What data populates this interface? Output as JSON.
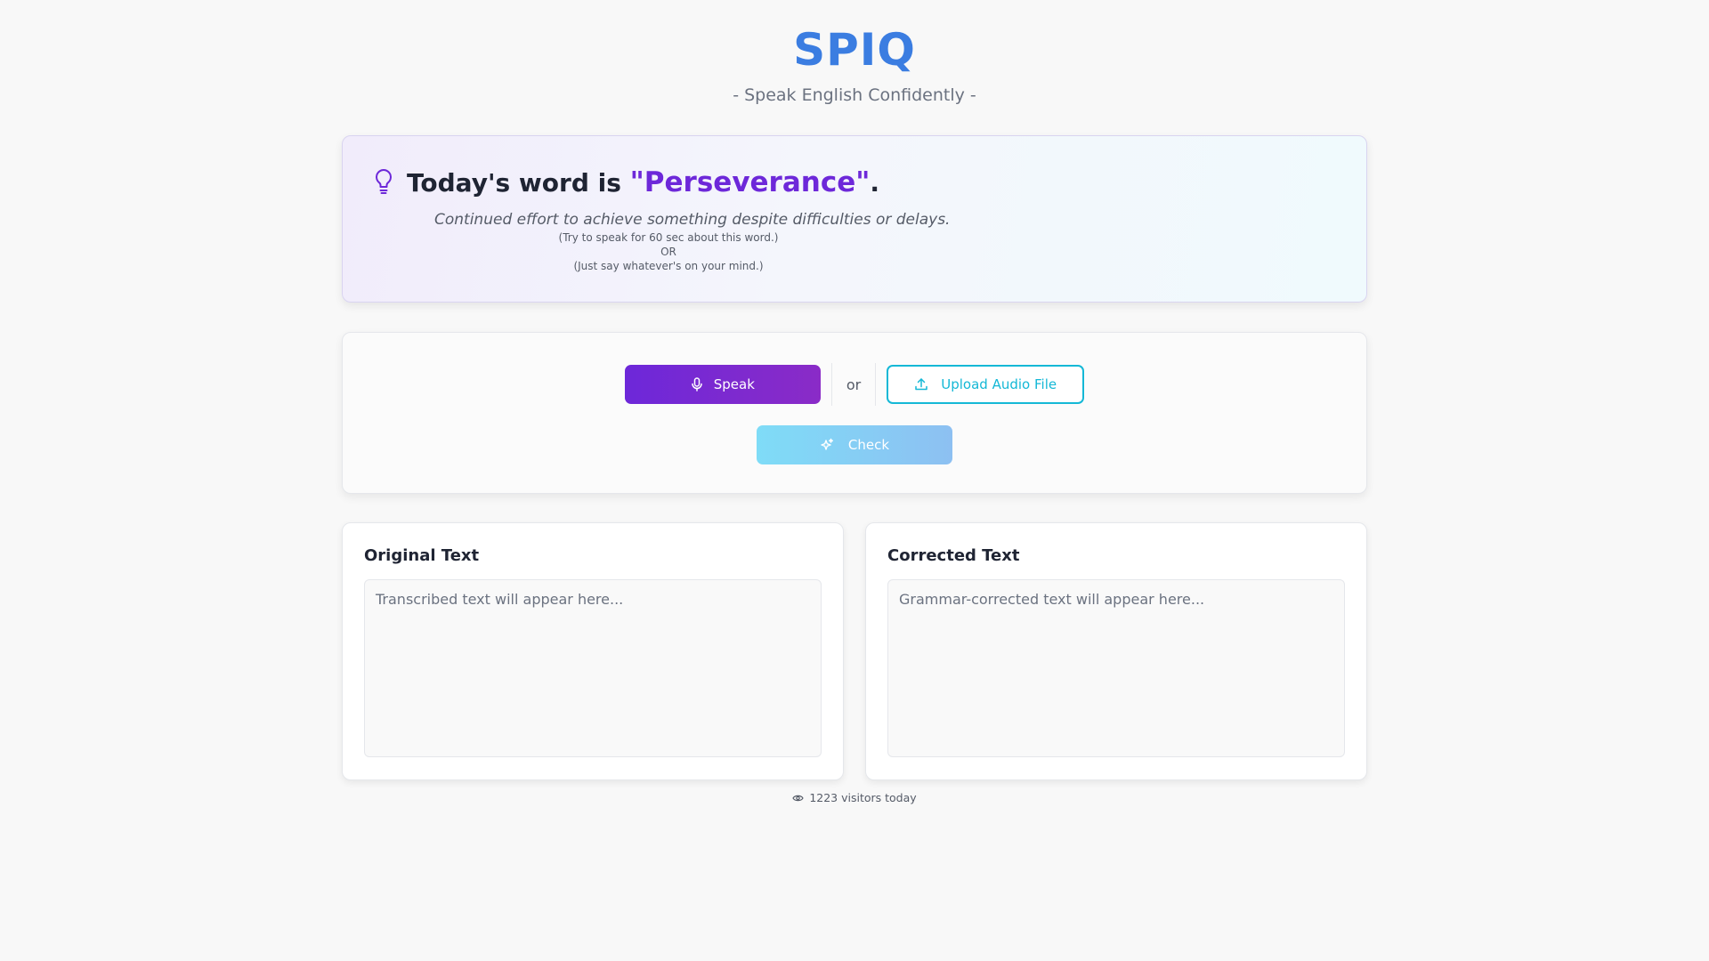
{
  "header": {
    "logo": "SPIQ",
    "tagline": "- Speak English Confidently -"
  },
  "word_card": {
    "title_prefix": "Today's word is ",
    "word": "\"Perseverance\"",
    "title_suffix": ".",
    "definition": "Continued effort to achieve something despite difficulties or delays.",
    "hint_line1": "(Try to speak for 60 sec about this word.)",
    "hint_line2": "OR",
    "hint_line3": "(Just say whatever's on your mind.)",
    "icon": "lightbulb-icon"
  },
  "actions": {
    "speak_label": "Speak",
    "or_label": "or",
    "upload_label": "Upload Audio File",
    "check_label": "Check"
  },
  "panels": {
    "original": {
      "title": "Original Text",
      "placeholder": "Transcribed text will appear here..."
    },
    "corrected": {
      "title": "Corrected Text",
      "placeholder": "Grammar-corrected text will appear here..."
    }
  },
  "footer": {
    "visitors": "1223 visitors today",
    "icon": "eye-icon"
  },
  "colors": {
    "brand": "#3b7de1",
    "accent_purple": "#6d28d9",
    "accent_cyan": "#14b8d6"
  }
}
